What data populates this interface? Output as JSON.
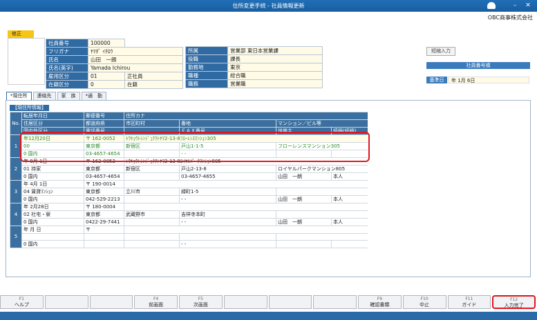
{
  "window": {
    "title": "住所変更手続 - 社員情報更新",
    "company": "OBC商事株式会社"
  },
  "badge": "修正",
  "employee": {
    "left": [
      {
        "label": "社員番号",
        "value": "100000"
      },
      {
        "label": "フリガナ",
        "value": "ﾔﾏﾀﾞ ｲﾁﾛｳ"
      },
      {
        "label": "氏名",
        "value": "山田　一朗"
      },
      {
        "label": "氏名(英字)",
        "value": "Yamada Ichirou"
      },
      {
        "label": "雇用区分",
        "code": "01",
        "value": "正社員"
      },
      {
        "label": "在籍区分",
        "code": "0",
        "value": "在籍"
      }
    ],
    "right": [
      {
        "label": "所属",
        "value": "営業部 東日本営業課"
      },
      {
        "label": "役職",
        "value": "課長"
      },
      {
        "label": "勤務地",
        "value": "東京"
      },
      {
        "label": "職種",
        "value": "総合職"
      },
      {
        "label": "職務",
        "value": "営業職"
      }
    ]
  },
  "short_input": "短縮入力",
  "empno_order": "社員番号順",
  "base_date": {
    "label": "基準日",
    "value": "年  1月  6日"
  },
  "tabs": [
    "*現住所",
    "連絡先",
    "家　族",
    "*通　勤"
  ],
  "section_label": "【現住所情報】",
  "grid": {
    "header1": [
      "転居年月日",
      "郵便番号",
      "住所カナ",
      "",
      "",
      ""
    ],
    "header2": [
      "住居区分",
      "都道府県",
      "市区町村",
      "番地",
      "マンション／ビル等",
      ""
    ],
    "header3": [
      "国内外区分",
      "電話番号",
      "",
      "ＦＡＸ番号",
      "世帯主",
      "続柄(続柄)"
    ],
    "no_label": "No.",
    "records": [
      {
        "no": "1",
        "rows": [
          [
            "年12月20日",
            "〒  162-0052",
            "ﾄｳｷｮｳﾄｼﾝｼﾞｭｸｸﾄﾔﾏ2-13-8ﾌﾛｰﾚﾝｽﾏﾝｼｮﾝ305",
            "",
            "",
            ""
          ],
          [
            "00",
            "東京都",
            "新宿区",
            "戸山1-1-5",
            "フローレンスマンション305",
            ""
          ],
          [
            "0  国内",
            "03-4657-4654",
            "",
            "-   -",
            "",
            ""
          ]
        ]
      },
      {
        "no": "2",
        "rows": [
          [
            "年  8月  1日",
            "〒  162-0052",
            "ﾄｳｷｮｳﾄｼﾝｼﾞｭｸｸﾄﾔﾏ2-13-8ﾛｲﾔﾙﾊﾟｰｸﾏﾝｼｮﾝ805",
            "",
            "",
            ""
          ],
          [
            "01  持家",
            "東京都",
            "新宿区",
            "戸山2-13-8",
            "ロイヤルパークマンション805",
            ""
          ],
          [
            "0  国内",
            "03-4657-4654",
            "",
            "03-4657-4655",
            "山田　一朗",
            "本人"
          ]
        ]
      },
      {
        "no": "3",
        "rows": [
          [
            "年  4月  1日",
            "〒  190-0014",
            "",
            "",
            "",
            ""
          ],
          [
            "04  賃貸ﾏﾝｼｮﾝ",
            "東京都",
            "立川市",
            "緑町1-5",
            "",
            ""
          ],
          [
            "0  国内",
            "042-529-2213",
            "",
            "-   -",
            "山田　一朗",
            "本人"
          ]
        ]
      },
      {
        "no": "4",
        "rows": [
          [
            "年  2月28日",
            "〒  180-0004",
            "",
            "",
            "",
            ""
          ],
          [
            "02  社宅・寮",
            "東京都",
            "武蔵野市",
            "吉祥寺本町",
            "",
            ""
          ],
          [
            "0  国内",
            "0422-29-7441",
            "",
            "-   -",
            "山田　一朗",
            "本人"
          ]
        ]
      },
      {
        "no": "5",
        "rows": [
          [
            "年    月    日",
            "〒",
            "",
            "",
            "",
            ""
          ],
          [
            "",
            "",
            "",
            "",
            "",
            ""
          ],
          [
            "0  国内",
            "",
            "",
            "-   -",
            "",
            ""
          ]
        ]
      }
    ]
  },
  "fkeys": [
    {
      "num": "F1",
      "label": "ヘルプ"
    },
    {
      "num": "",
      "label": ""
    },
    {
      "num": "",
      "label": ""
    },
    {
      "num": "F4",
      "label": "前画面"
    },
    {
      "num": "F5",
      "label": "次画面"
    },
    {
      "num": "",
      "label": ""
    },
    {
      "num": "",
      "label": ""
    },
    {
      "num": "",
      "label": ""
    },
    {
      "num": "F9",
      "label": "確認書類"
    },
    {
      "num": "F10",
      "label": "中止"
    },
    {
      "num": "F11",
      "label": "ガイド"
    },
    {
      "num": "F12",
      "label": "入力完了"
    }
  ]
}
